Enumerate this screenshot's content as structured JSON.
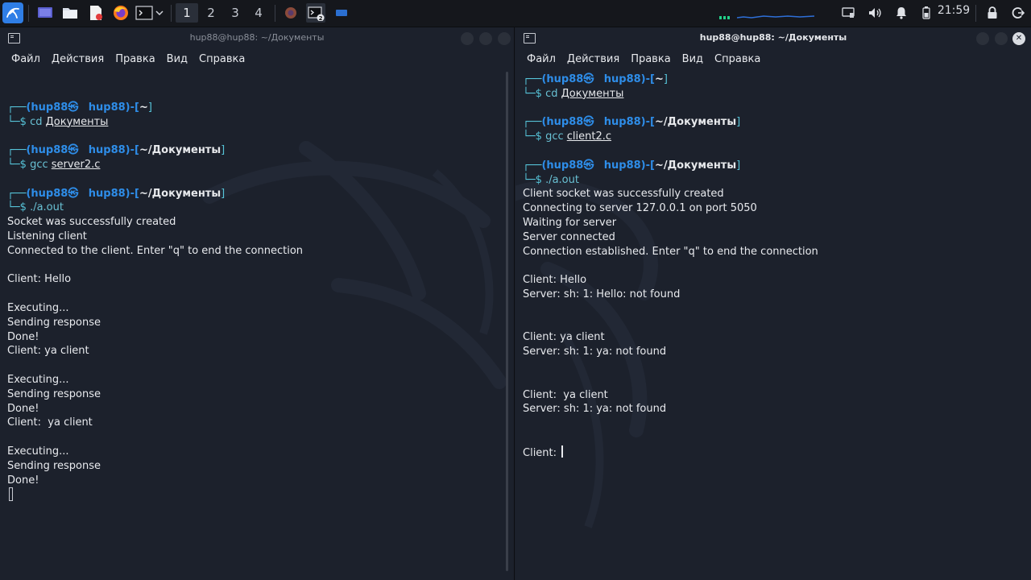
{
  "taskbar": {
    "workspaces": [
      "1",
      "2",
      "3",
      "4"
    ],
    "active_workspace_index": 0,
    "clock": "21:59",
    "terminal_badge": "2"
  },
  "left": {
    "title": "hup88@hup88: ~/Документы",
    "menu": [
      "Файл",
      "Действия",
      "Правка",
      "Вид",
      "Справка"
    ],
    "blocks": [
      {
        "user": "(hup88㉿",
        "host": "hup88)-[",
        "path": "~",
        "close": "]",
        "cmd": "cd",
        "arg": "Документы"
      },
      {
        "user": "(hup88㉿",
        "host": "hup88)-[",
        "path": "~/Документы",
        "close": "]",
        "cmd": "gcc",
        "arg": "server2.c"
      },
      {
        "user": "(hup88㉿",
        "host": "hup88)-[",
        "path": "~/Документы",
        "close": "]",
        "cmd": "./a.out",
        "arg": ""
      }
    ],
    "output": [
      "Socket was successfully created",
      "Listening client",
      "Connected to the client. Enter \"q\" to end the connection",
      "",
      "Client: Hello",
      "",
      "Executing...",
      "Sending response",
      "Done!",
      "Client: ya client",
      "",
      "Executing...",
      "Sending response",
      "Done!",
      "Client:  ya client",
      "",
      "Executing...",
      "Sending response",
      "Done!"
    ]
  },
  "right": {
    "title": "hup88@hup88: ~/Документы",
    "menu": [
      "Файл",
      "Действия",
      "Правка",
      "Вид",
      "Справка"
    ],
    "blocks": [
      {
        "user": "(hup88㉿",
        "host": "hup88)-[",
        "path": "~",
        "close": "]",
        "cmd": "cd",
        "arg": "Документы"
      },
      {
        "user": "(hup88㉿",
        "host": "hup88)-[",
        "path": "~/Документы",
        "close": "]",
        "cmd": "gcc",
        "arg": "client2.c"
      },
      {
        "user": "(hup88㉿",
        "host": "hup88)-[",
        "path": "~/Документы",
        "close": "]",
        "cmd": "./a.out",
        "arg": ""
      }
    ],
    "output": [
      "Client socket was successfully created",
      "Connecting to server 127.0.0.1 on port 5050",
      "Waiting for server",
      "Server connected",
      "Connection established. Enter \"q\" to end the connection",
      "",
      "Client: Hello",
      "Server: sh: 1: Hello: not found",
      "",
      "",
      "Client: ya client",
      "Server: sh: 1: ya: not found",
      "",
      "",
      "Client:  ya client",
      "Server: sh: 1: ya: not found",
      "",
      "",
      "Client: "
    ]
  },
  "colors": {
    "prompt_blue": "#2e8de8",
    "prompt_cyan": "#56c4d9",
    "terminal_bg": "#1c212c",
    "panel_bg": "#15171c"
  }
}
